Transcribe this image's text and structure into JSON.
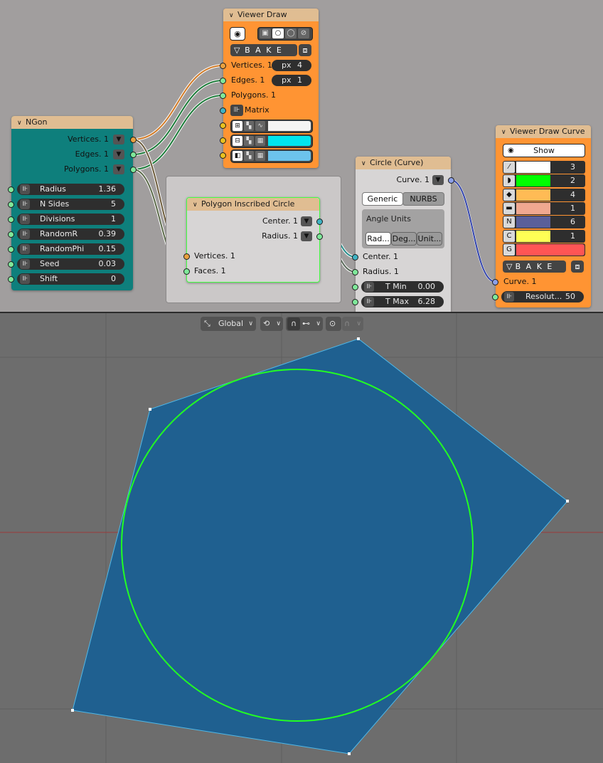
{
  "colors": {
    "editor_bg": "#a19e9e",
    "viewport_bg": "#6d6d6d",
    "teal_node": "#0e7f7c",
    "orange_node": "#ff9433",
    "polygon_fill": "#1f6090",
    "circle_line": "#22ff22"
  },
  "ngon": {
    "title": "NGon",
    "outputs": [
      "Vertices. 1",
      "Edges. 1",
      "Polygons. 1"
    ],
    "params": [
      {
        "label": "Radius",
        "value": "1.36"
      },
      {
        "label": "N Sides",
        "value": "5"
      },
      {
        "label": "Divisions",
        "value": "1"
      },
      {
        "label": "RandomR",
        "value": "0.39"
      },
      {
        "label": "RandomPhi",
        "value": "0.15"
      },
      {
        "label": "Seed",
        "value": "0.03"
      },
      {
        "label": "Shift",
        "value": "0"
      }
    ]
  },
  "viewer_draw": {
    "title": "Viewer Draw",
    "bake": "B A K E",
    "inputs": [
      {
        "label": "Vertices. 1",
        "field": "px",
        "value": "4"
      },
      {
        "label": "Edges. 1",
        "field": "px",
        "value": "1"
      },
      {
        "label": "Polygons. 1"
      },
      {
        "label": "Matrix"
      }
    ]
  },
  "frame": {
    "title": "Polygon Inscribed Circle",
    "outputs": [
      "Center. 1",
      "Radius. 1"
    ],
    "inputs": [
      "Vertices. 1",
      "Faces. 1"
    ]
  },
  "circle": {
    "title": "Circle (Curve)",
    "output": "Curve. 1",
    "tabs": [
      "Generic",
      "NURBS"
    ],
    "angle_label": "Angle Units",
    "units": [
      "Rad...",
      "Deg...",
      "Unit..."
    ],
    "inputs": [
      "Center. 1",
      "Radius. 1"
    ],
    "fields": [
      {
        "label": "T Min",
        "value": "0.00"
      },
      {
        "label": "T Max",
        "value": "6.28"
      }
    ]
  },
  "vdc": {
    "title": "Viewer Draw Curve",
    "show": "Show",
    "rows": [
      {
        "icon": "⁄",
        "color": "#ffffff",
        "value": "3"
      },
      {
        "icon": "◗",
        "color": "#00ff00",
        "value": "2"
      },
      {
        "icon": "◆",
        "color": "#ffbb55",
        "value": "4"
      },
      {
        "icon": "▬",
        "color": "#f0a890",
        "value": "1"
      },
      {
        "icon": "N",
        "color": "#5a5f9a",
        "value": "6"
      },
      {
        "icon": "C",
        "color": "#ffff55",
        "value": "1"
      },
      {
        "icon": "G",
        "color": "#ff5555",
        "value": ""
      }
    ],
    "bake": "B A K E",
    "input": "Curve. 1",
    "res_label": "Resolut...",
    "res_value": "50"
  },
  "toolbar": {
    "orientation": "Global"
  }
}
